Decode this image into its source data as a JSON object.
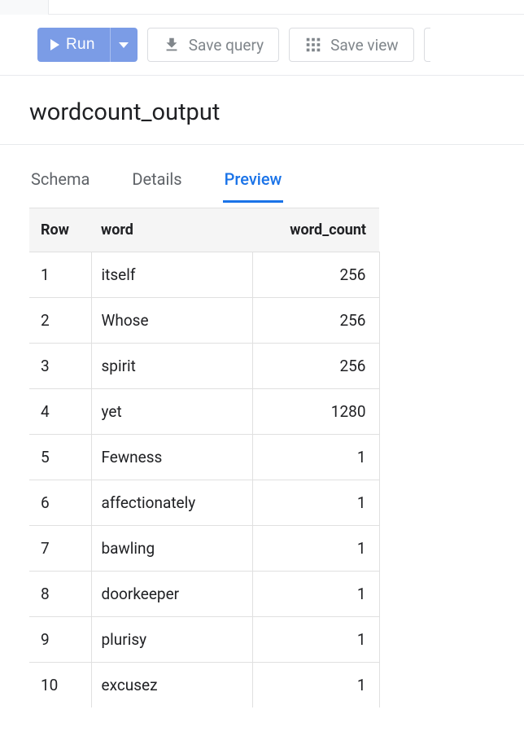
{
  "toolbar": {
    "run_label": "Run",
    "save_query_label": "Save query",
    "save_view_label": "Save view"
  },
  "title": "wordcount_output",
  "tabs": {
    "items": [
      {
        "label": "Schema",
        "active": false
      },
      {
        "label": "Details",
        "active": false
      },
      {
        "label": "Preview",
        "active": true
      }
    ]
  },
  "table": {
    "columns": {
      "row": "Row",
      "word": "word",
      "word_count": "word_count"
    },
    "rows": [
      {
        "row": "1",
        "word": "itself",
        "word_count": "256"
      },
      {
        "row": "2",
        "word": "Whose",
        "word_count": "256"
      },
      {
        "row": "3",
        "word": "spirit",
        "word_count": "256"
      },
      {
        "row": "4",
        "word": "yet",
        "word_count": "1280"
      },
      {
        "row": "5",
        "word": "Fewness",
        "word_count": "1"
      },
      {
        "row": "6",
        "word": "affectionately",
        "word_count": "1"
      },
      {
        "row": "7",
        "word": "bawling",
        "word_count": "1"
      },
      {
        "row": "8",
        "word": "doorkeeper",
        "word_count": "1"
      },
      {
        "row": "9",
        "word": "plurisy",
        "word_count": "1"
      },
      {
        "row": "10",
        "word": "excusez",
        "word_count": "1"
      }
    ]
  }
}
